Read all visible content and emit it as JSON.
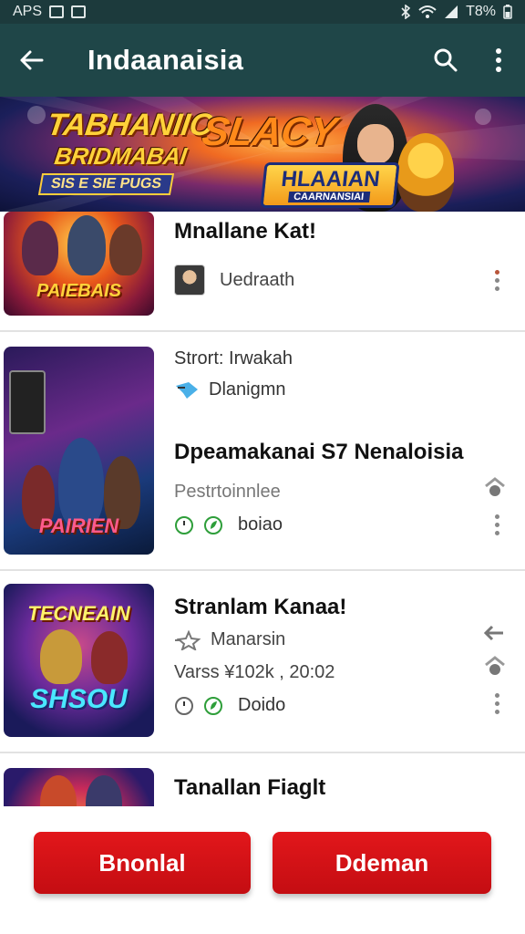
{
  "status_bar": {
    "left_text": "APS",
    "battery": "T8%"
  },
  "app_bar": {
    "title": "Indaanaisia"
  },
  "banner": {
    "line1": "TABHANIIO",
    "line2": "SLACY",
    "line3": "BRIDMABAI",
    "strip": "SIS E SIE PUGS",
    "badge_title": "HLAAIAN",
    "badge_sub": "CAARNANSIAI"
  },
  "items": [
    {
      "title": "Mnallane Kat!",
      "owner": "Uedraath",
      "thumb_text": "PAIEBAIS"
    },
    {
      "line1": "Strort: Irwakah",
      "line2": "Dlanigmn",
      "title": "Dpeamakanai S7 Nenaloisia",
      "line3": "Pestrtoinnlee",
      "line4": "boiao",
      "thumb_text": "PAIRIEN"
    },
    {
      "title": "Stranlam Kanaa!",
      "line2": "Manarsin",
      "line3": "Varss ¥102k , 20:02",
      "line4": "Doido",
      "thumb_text": "TECNEAIN",
      "thumb_text2": "SHSOU"
    },
    {
      "title": "Tanallan Fiaglt"
    }
  ],
  "buttons": {
    "left": "Bnonlal",
    "right": "Ddeman"
  },
  "colors": {
    "app_bar": "#1f4648",
    "status_bar": "#1c3a3c",
    "cta": "#d81219",
    "green": "#2e9e3a"
  }
}
